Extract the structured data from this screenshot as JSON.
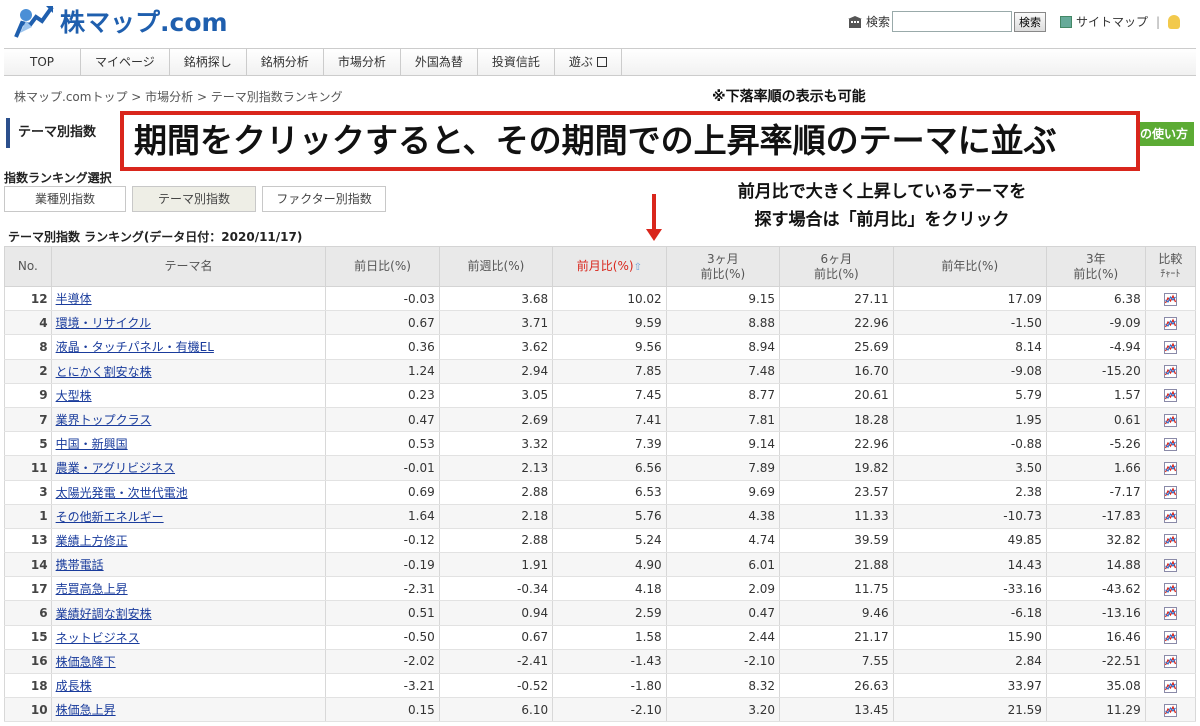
{
  "header": {
    "logo_text": "株マップ.com",
    "search_label": "検索",
    "search_button": "検索",
    "sitemap": "サイトマップ",
    "separator": "|"
  },
  "nav": [
    "TOP",
    "マイページ",
    "銘柄探し",
    "銘柄分析",
    "市場分析",
    "外国為替",
    "投資信託",
    "遊ぶ"
  ],
  "breadcrumb": "株マップ.comトップ > 市場分析 > テーマ別指数ランキング",
  "page_title": "テーマ別指数",
  "right_button": "の使い方",
  "annotations": {
    "top_note": "※下落率順の表示も可能",
    "big_note": "期間をクリックすると、その期間での上昇率順のテーマに並ぶ",
    "note2_line1": "前月比で大きく上昇しているテーマを",
    "note2_line2": "探す場合は「前月比」をクリック"
  },
  "selection": {
    "label": "指数ランキング選択",
    "tabs": [
      "業種別指数",
      "テーマ別指数",
      "ファクター別指数"
    ]
  },
  "table_caption": "テーマ別指数 ランキング(データ日付：2020/11/17)",
  "columns": {
    "no": "No.",
    "name": "テーマ名",
    "day": "前日比(%)",
    "week": "前週比(%)",
    "month": "前月比(%)",
    "m3_line1": "3ヶ月",
    "m3_line2": "前比(%)",
    "m6_line1": "6ヶ月",
    "m6_line2": "前比(%)",
    "year": "前年比(%)",
    "y3_line1": "3年",
    "y3_line2": "前比(%)",
    "chart_line1": "比較",
    "chart_line2": "ﾁｬｰﾄ"
  },
  "rows": [
    {
      "no": "12",
      "name": "半導体",
      "day": "-0.03",
      "week": "3.68",
      "month": "10.02",
      "m3": "9.15",
      "m6": "27.11",
      "year": "17.09",
      "y3": "6.38"
    },
    {
      "no": "4",
      "name": "環境・リサイクル",
      "day": "0.67",
      "week": "3.71",
      "month": "9.59",
      "m3": "8.88",
      "m6": "22.96",
      "year": "-1.50",
      "y3": "-9.09"
    },
    {
      "no": "8",
      "name": "液晶・タッチパネル・有機EL",
      "day": "0.36",
      "week": "3.62",
      "month": "9.56",
      "m3": "8.94",
      "m6": "25.69",
      "year": "8.14",
      "y3": "-4.94"
    },
    {
      "no": "2",
      "name": "とにかく割安な株",
      "day": "1.24",
      "week": "2.94",
      "month": "7.85",
      "m3": "7.48",
      "m6": "16.70",
      "year": "-9.08",
      "y3": "-15.20"
    },
    {
      "no": "9",
      "name": "大型株",
      "day": "0.23",
      "week": "3.05",
      "month": "7.45",
      "m3": "8.77",
      "m6": "20.61",
      "year": "5.79",
      "y3": "1.57"
    },
    {
      "no": "7",
      "name": "業界トップクラス",
      "day": "0.47",
      "week": "2.69",
      "month": "7.41",
      "m3": "7.81",
      "m6": "18.28",
      "year": "1.95",
      "y3": "0.61"
    },
    {
      "no": "5",
      "name": "中国・新興国",
      "day": "0.53",
      "week": "3.32",
      "month": "7.39",
      "m3": "9.14",
      "m6": "22.96",
      "year": "-0.88",
      "y3": "-5.26"
    },
    {
      "no": "11",
      "name": "農業・アグリビジネス",
      "day": "-0.01",
      "week": "2.13",
      "month": "6.56",
      "m3": "7.89",
      "m6": "19.82",
      "year": "3.50",
      "y3": "1.66"
    },
    {
      "no": "3",
      "name": "太陽光発電・次世代電池",
      "day": "0.69",
      "week": "2.88",
      "month": "6.53",
      "m3": "9.69",
      "m6": "23.57",
      "year": "2.38",
      "y3": "-7.17"
    },
    {
      "no": "1",
      "name": "その他新エネルギー",
      "day": "1.64",
      "week": "2.18",
      "month": "5.76",
      "m3": "4.38",
      "m6": "11.33",
      "year": "-10.73",
      "y3": "-17.83"
    },
    {
      "no": "13",
      "name": "業績上方修正",
      "day": "-0.12",
      "week": "2.88",
      "month": "5.24",
      "m3": "4.74",
      "m6": "39.59",
      "year": "49.85",
      "y3": "32.82"
    },
    {
      "no": "14",
      "name": "携帯電話",
      "day": "-0.19",
      "week": "1.91",
      "month": "4.90",
      "m3": "6.01",
      "m6": "21.88",
      "year": "14.43",
      "y3": "14.88"
    },
    {
      "no": "17",
      "name": "売買高急上昇",
      "day": "-2.31",
      "week": "-0.34",
      "month": "4.18",
      "m3": "2.09",
      "m6": "11.75",
      "year": "-33.16",
      "y3": "-43.62"
    },
    {
      "no": "6",
      "name": "業績好調な割安株",
      "day": "0.51",
      "week": "0.94",
      "month": "2.59",
      "m3": "0.47",
      "m6": "9.46",
      "year": "-6.18",
      "y3": "-13.16"
    },
    {
      "no": "15",
      "name": "ネットビジネス",
      "day": "-0.50",
      "week": "0.67",
      "month": "1.58",
      "m3": "2.44",
      "m6": "21.17",
      "year": "15.90",
      "y3": "16.46"
    },
    {
      "no": "16",
      "name": "株価急降下",
      "day": "-2.02",
      "week": "-2.41",
      "month": "-1.43",
      "m3": "-2.10",
      "m6": "7.55",
      "year": "2.84",
      "y3": "-22.51"
    },
    {
      "no": "18",
      "name": "成長株",
      "day": "-3.21",
      "week": "-0.52",
      "month": "-1.80",
      "m3": "8.32",
      "m6": "26.63",
      "year": "33.97",
      "y3": "35.08"
    },
    {
      "no": "10",
      "name": "株価急上昇",
      "day": "0.15",
      "week": "6.10",
      "month": "-2.10",
      "m3": "3.20",
      "m6": "13.45",
      "year": "21.59",
      "y3": "11.29"
    }
  ],
  "colors": {
    "brand": "#1f5fae",
    "annotation_red": "#d9261c",
    "link": "#1a3c9c"
  },
  "icons": [
    "building-icon",
    "sitemap-icon",
    "bulb-icon",
    "external-window-icon",
    "sort-arrow-icon",
    "compare-chart-icon"
  ]
}
